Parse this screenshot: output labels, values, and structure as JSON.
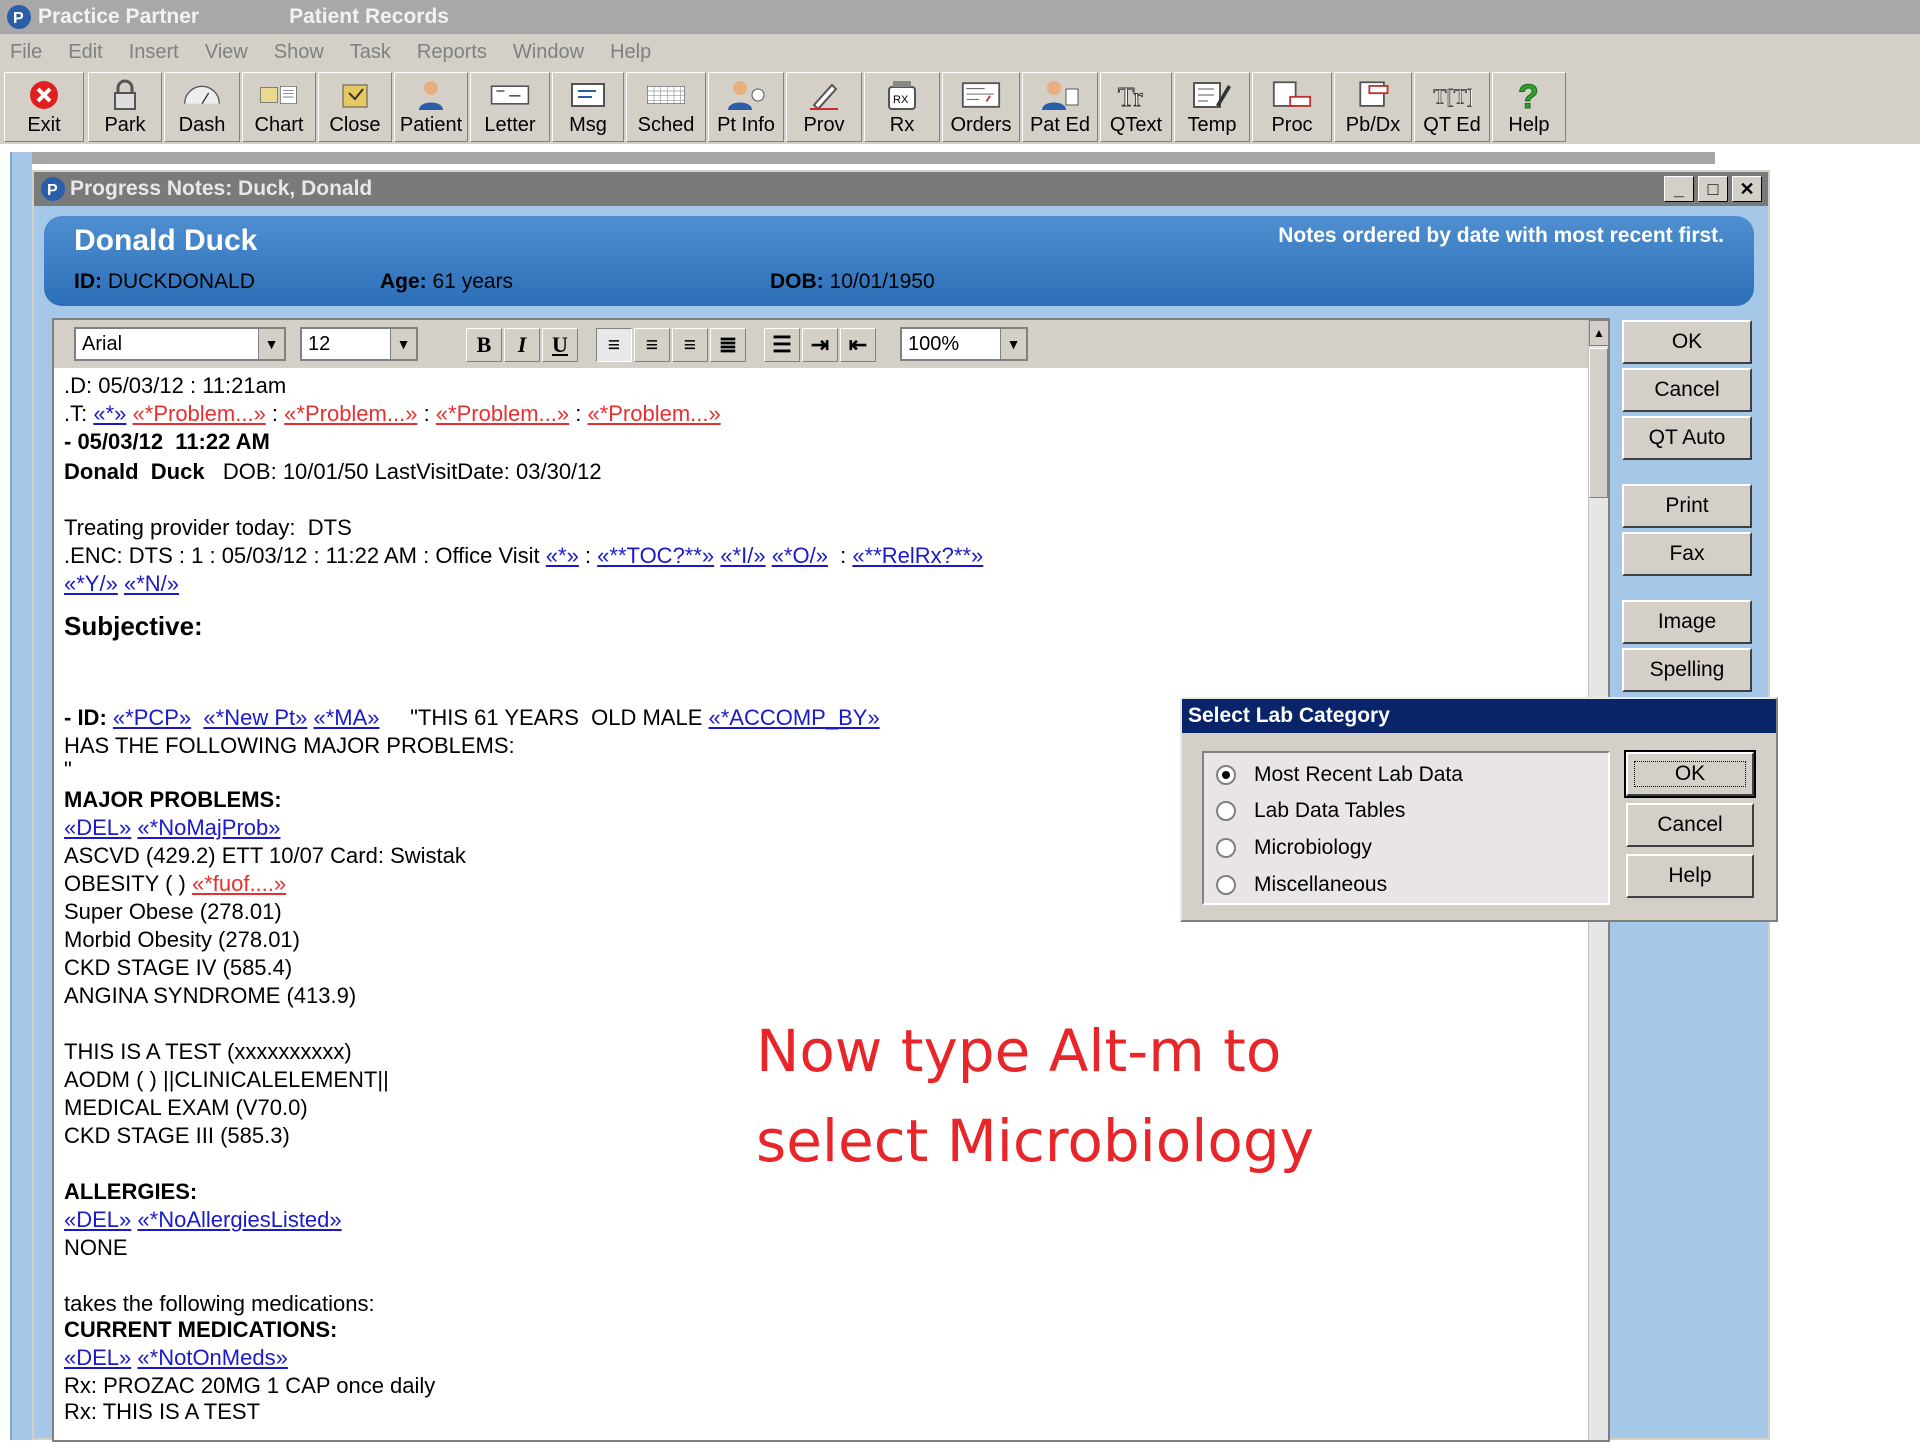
{
  "app": {
    "title": "Practice Partner",
    "subtitle": "Patient Records",
    "menu": [
      "File",
      "Edit",
      "Insert",
      "View",
      "Show",
      "Task",
      "Reports",
      "Window",
      "Help"
    ],
    "toolbar": [
      "Exit",
      "Park",
      "Dash",
      "Chart",
      "Close",
      "Patient",
      "Letter",
      "Msg",
      "Sched",
      "Pt Info",
      "Prov",
      "Rx",
      "Orders",
      "Pat Ed",
      "QText",
      "Temp",
      "Proc",
      "Pb/Dx",
      "QT Ed",
      "Help"
    ]
  },
  "notes_window": {
    "title": "Progress Notes: Duck, Donald",
    "patient_name": "Donald Duck",
    "order_note": "Notes ordered by date with most recent first.",
    "id_label": "ID:",
    "id_value": "DUCKDONALD",
    "age_label": "Age:",
    "age_value": "61 years",
    "dob_label": "DOB:",
    "dob_value": "10/01/1950",
    "font_name": "Arial",
    "font_size": "12",
    "zoom": "100%",
    "side_buttons": [
      "OK",
      "Cancel",
      "QT Auto",
      "Print",
      "Fax",
      "Image",
      "Spelling"
    ]
  },
  "doc": {
    "d_line": ".D: 05/03/12 : 11:21am",
    "t_prefix": ".T: ",
    "t_link1": "«*»",
    "problem1": "«*Problem...»",
    "problem2": "«*Problem...»",
    "problem3": "«*Problem...»",
    "problem4": "«*Problem...»",
    "sep": " : ",
    "date_line": "- 05/03/12  11:22 AM",
    "name_bold": "Donald  Duck",
    "dob_line": "   DOB: 10/01/50 LastVisitDate: 03/30/12",
    "treating": "Treating provider today:  DTS",
    "enc_prefix": ".ENC: DTS : 1 : 05/03/12 : 11:22 AM : Office Visit ",
    "enc_l1": "«*»",
    "enc_l2": "«**TOC?**»",
    "enc_l3": "«*I/»",
    "enc_l4": "«*O/»",
    "enc_l5": "«**RelRx?**»",
    "yn_l1": "«*Y/»",
    "yn_l2": "«*N/»",
    "subjective": "Subjective:",
    "id_prefix": "- ID: ",
    "id_l1": "«*PCP»",
    "id_l2": "«*New Pt»",
    "id_l3": "«*MA»",
    "id_text": "     \"THIS 61 YEARS  OLD MALE ",
    "id_l4": "«*ACCOMP_BY»",
    "has_following": "HAS THE FOLLOWING MAJOR PROBLEMS:",
    "quote": "\"",
    "major_problems": "MAJOR PROBLEMS:",
    "del": "«DEL»",
    "no_maj_prob": "«*NoMajProb»",
    "prob_list_1": "ASCVD (429.2) ETT 10/07 Card: Swistak",
    "obesity": "OBESITY ( ) ",
    "fuof": "«*fuof....»",
    "prob_list_2": [
      "Super Obese (278.01)",
      "Morbid Obesity (278.01)",
      "CKD STAGE IV (585.4)",
      "ANGINA SYNDROME (413.9)"
    ],
    "prob_list_3": [
      "THIS IS A TEST (xxxxxxxxxx)",
      "AODM ( ) ||CLINICALELEMENT||",
      "MEDICAL EXAM (V70.0)",
      "CKD STAGE III (585.3)"
    ],
    "allergies": "ALLERGIES:",
    "del2": "«DEL»",
    "no_allergies": "«*NoAllergiesListed»",
    "none": "NONE",
    "takes_meds": "takes the following medications:",
    "current_meds": "CURRENT MEDICATIONS:",
    "del3": "«DEL»",
    "not_on_meds": "«*NotOnMeds»",
    "rx1": "Rx: PROZAC 20MG 1 CAP once daily",
    "rx2": "Rx: THIS IS A TEST"
  },
  "lab_dialog": {
    "title": "Select Lab Category",
    "options": [
      "Most Recent Lab Data",
      "Lab Data Tables",
      "Microbiology",
      "Miscellaneous"
    ],
    "selected": 0,
    "buttons": [
      "OK",
      "Cancel",
      "Help"
    ]
  },
  "overlay": {
    "line1": "Now type Alt-m to",
    "line2": "select Microbiology"
  }
}
